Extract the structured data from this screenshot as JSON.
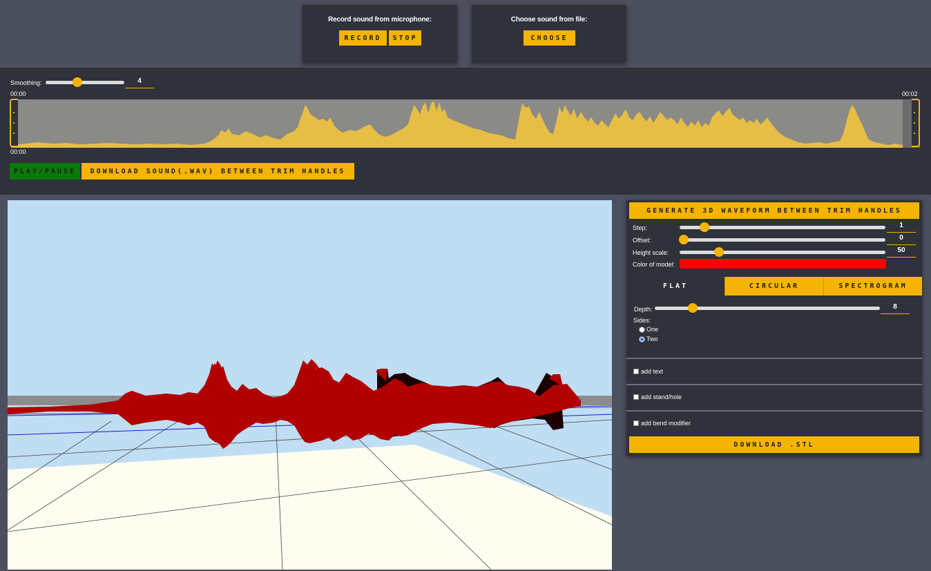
{
  "record": {
    "title": "Record sound from microphone:",
    "record_label": "RECORD",
    "stop_label": "STOP"
  },
  "file": {
    "title": "Choose sound from file:",
    "choose_label": "CHOOSE"
  },
  "trim": {
    "smoothing_label": "Smoothing:",
    "smoothing_value": "4",
    "smoothing_fraction": 0.4,
    "time_start_top": "00:00",
    "time_end": "00:02",
    "time_start_bottom": "00:00",
    "play_label": "PLAY/PAUSE",
    "download_wav_label": "DOWNLOAD SOUND(.WAV) BETWEEN TRIM HANDLES"
  },
  "controls": {
    "generate_label": "GENERATE 3D WAVEFORM BETWEEN TRIM HANDLES",
    "step_label": "Step:",
    "step_value": "1",
    "step_fraction": 0.12,
    "offset_label": "Offset:",
    "offset_value": "0",
    "offset_fraction": 0.02,
    "height_label": "Height scale:",
    "height_value": "50",
    "height_fraction": 0.19,
    "color_label": "Color of model:",
    "model_color": "#ff0000",
    "tabs": [
      {
        "label": "FLAT",
        "active": true
      },
      {
        "label": "CIRCULAR",
        "active": false
      },
      {
        "label": "SPECTROGRAM",
        "active": false
      }
    ],
    "depth_label": "Depth:",
    "depth_value": "8",
    "depth_fraction": 0.17,
    "sides_label": "Sides:",
    "side_one": "One",
    "side_two": "Two",
    "add_text": "add text",
    "add_stand": "add stand/hole",
    "add_bend": "add bend modifier",
    "download_stl_label": "DOWNLOAD .STL"
  },
  "colors": {
    "accent": "#f5b400",
    "play_button": "#0a7a0a",
    "panel": "#2f313b",
    "background": "#4b4f5e",
    "sky": "#c0def3",
    "model": "#b00000"
  }
}
